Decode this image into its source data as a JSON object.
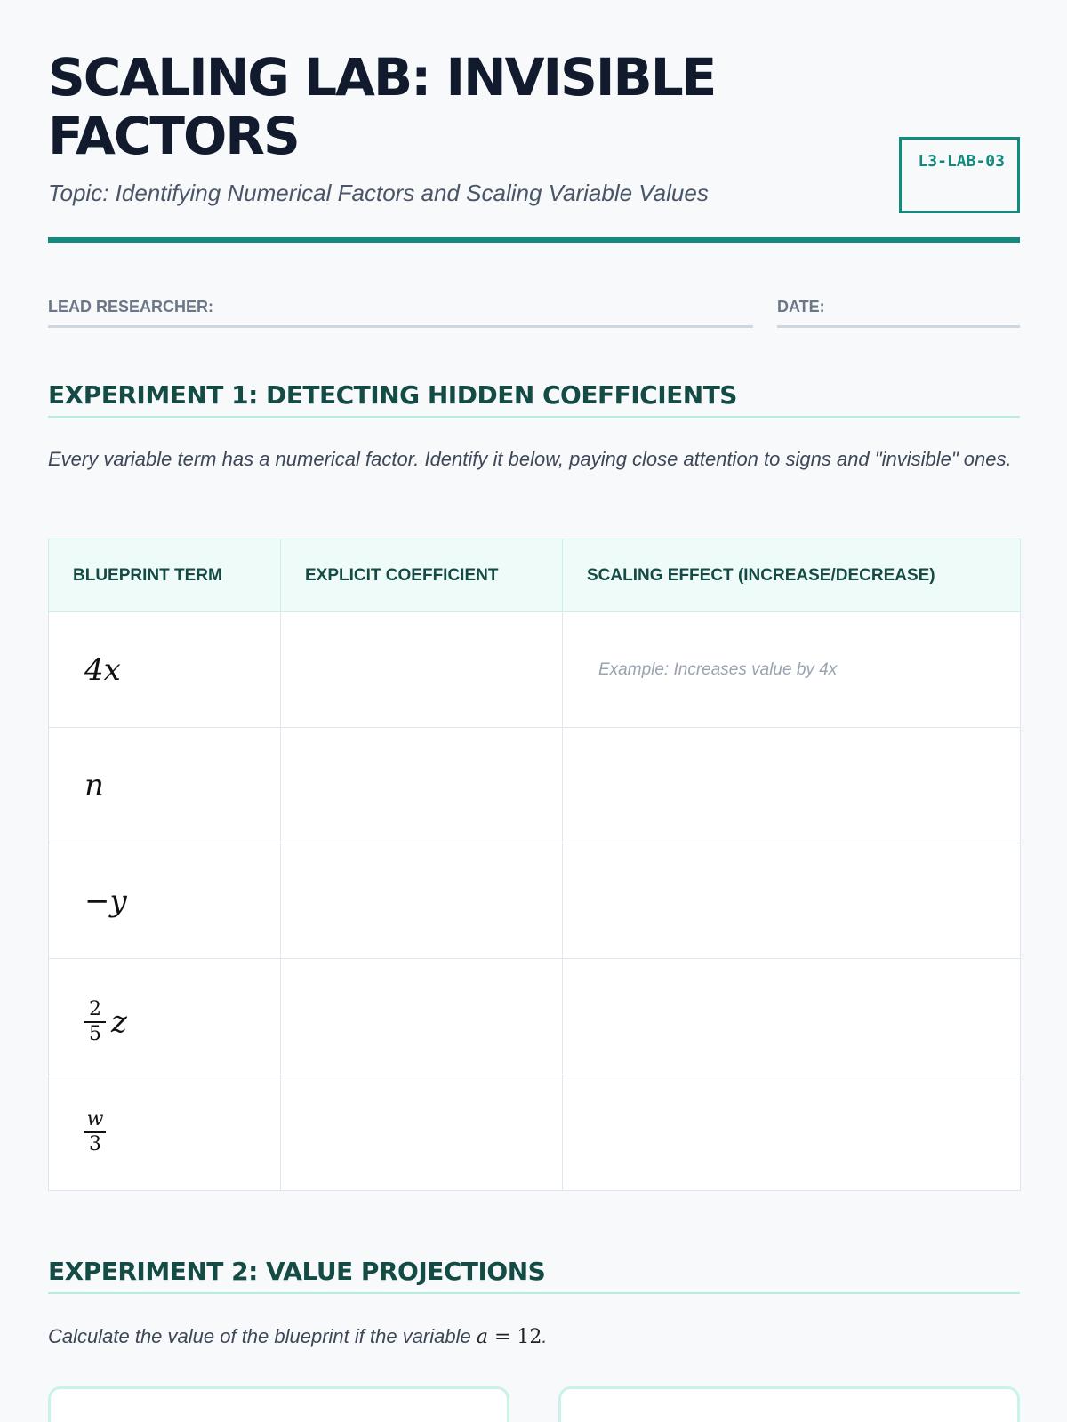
{
  "header": {
    "title": "SCALING LAB: INVISIBLE FACTORS",
    "subtitle": "Topic: Identifying Numerical Factors and Scaling Variable Values",
    "lab_code": "L3-LAB-03"
  },
  "fields": {
    "researcher_label": "LEAD RESEARCHER:",
    "date_label": "DATE:"
  },
  "experiment1": {
    "title": "EXPERIMENT 1: DETECTING HIDDEN COEFFICIENTS",
    "instructions": "Every variable term has a numerical factor. Identify it below, paying close attention to signs and \"invisible\" ones.",
    "columns": [
      "BLUEPRINT TERM",
      "EXPLICIT COEFFICIENT",
      "SCALING EFFECT (INCREASE/DECREASE)"
    ],
    "rows": [
      {
        "term": "4x",
        "coefficient": "",
        "effect": "Example: Increases value by 4x"
      },
      {
        "term": "n",
        "coefficient": "",
        "effect": ""
      },
      {
        "term": "−y",
        "coefficient": "",
        "effect": ""
      },
      {
        "term_num": "2",
        "term_den": "5",
        "term_var": "z",
        "coefficient": "",
        "effect": ""
      },
      {
        "term_num": "w",
        "term_den": "3",
        "coefficient": "",
        "effect": ""
      }
    ]
  },
  "experiment2": {
    "title": "EXPERIMENT 2: VALUE PROJECTIONS",
    "instructions_prefix": "Calculate the value of the blueprint if the variable ",
    "variable": "a",
    "equals": " = ",
    "value": "12",
    "suffix": "."
  },
  "colors": {
    "accent": "#128a7e",
    "heading": "#144b45",
    "title": "#121b2e"
  }
}
